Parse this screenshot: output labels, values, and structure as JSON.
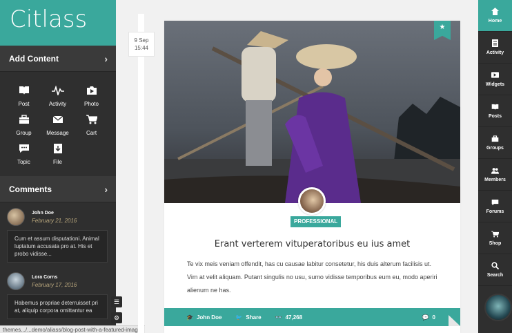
{
  "logo": {
    "text": "Citlass"
  },
  "add_content": {
    "title": "Add Content",
    "items": [
      {
        "label": "Post",
        "icon": "book-icon"
      },
      {
        "label": "Activity",
        "icon": "activity-pulse-icon"
      },
      {
        "label": "Photo",
        "icon": "camera-icon"
      },
      {
        "label": "Group",
        "icon": "briefcase-icon"
      },
      {
        "label": "Message",
        "icon": "envelope-icon"
      },
      {
        "label": "Cart",
        "icon": "cart-icon"
      },
      {
        "label": "Topic",
        "icon": "chat-icon"
      },
      {
        "label": "File",
        "icon": "file-icon"
      }
    ]
  },
  "comments": {
    "title": "Comments",
    "items": [
      {
        "name": "John Doe",
        "date": "February 21, 2016",
        "text": "Cum et assum disputationi. Animal luptatum accusata pro at. His et probo vidisse..."
      },
      {
        "name": "Lora Corns",
        "date": "February 17, 2016",
        "text": "Habemus propriae deterruisset pri at, aliquip corpora omittantur ea"
      }
    ]
  },
  "status_bar": {
    "url": "themes.../...demo/aliass/blog-post-with-a-featured-image/"
  },
  "timeline": {
    "date_day": "9 Sep",
    "date_time": "15:44"
  },
  "post": {
    "category": "PROFESSIONAL",
    "title": "Erant verterem vituperatoribus eu ius amet",
    "excerpt": "Te vix meis veniam offendit, has cu causae labitur consetetur, his duis alterum facilisis ut. Vim at velit aliquam. Putant singulis no usu, sumo vidisse temporibus eum eu, modo aperiri alienum ne has.",
    "author": "John Doe",
    "share_label": "Share",
    "views": "47,268",
    "comments_count": "0"
  },
  "right_nav": {
    "items": [
      {
        "label": "Home",
        "icon": "home-icon",
        "active": true
      },
      {
        "label": "Activity",
        "icon": "activity-icon",
        "active": false
      },
      {
        "label": "Widgets",
        "icon": "widgets-icon",
        "active": false
      },
      {
        "label": "Posts",
        "icon": "book-icon",
        "active": false
      },
      {
        "label": "Groups",
        "icon": "briefcase-icon",
        "active": false
      },
      {
        "label": "Members",
        "icon": "members-icon",
        "active": false
      },
      {
        "label": "Forums",
        "icon": "chat-icon",
        "active": false
      },
      {
        "label": "Shop",
        "icon": "cart-icon",
        "active": false
      },
      {
        "label": "Search",
        "icon": "search-icon",
        "active": false
      }
    ]
  },
  "colors": {
    "accent": "#3aa89c",
    "sidebar": "#2f2f2f",
    "date_text": "#b9a77d"
  }
}
